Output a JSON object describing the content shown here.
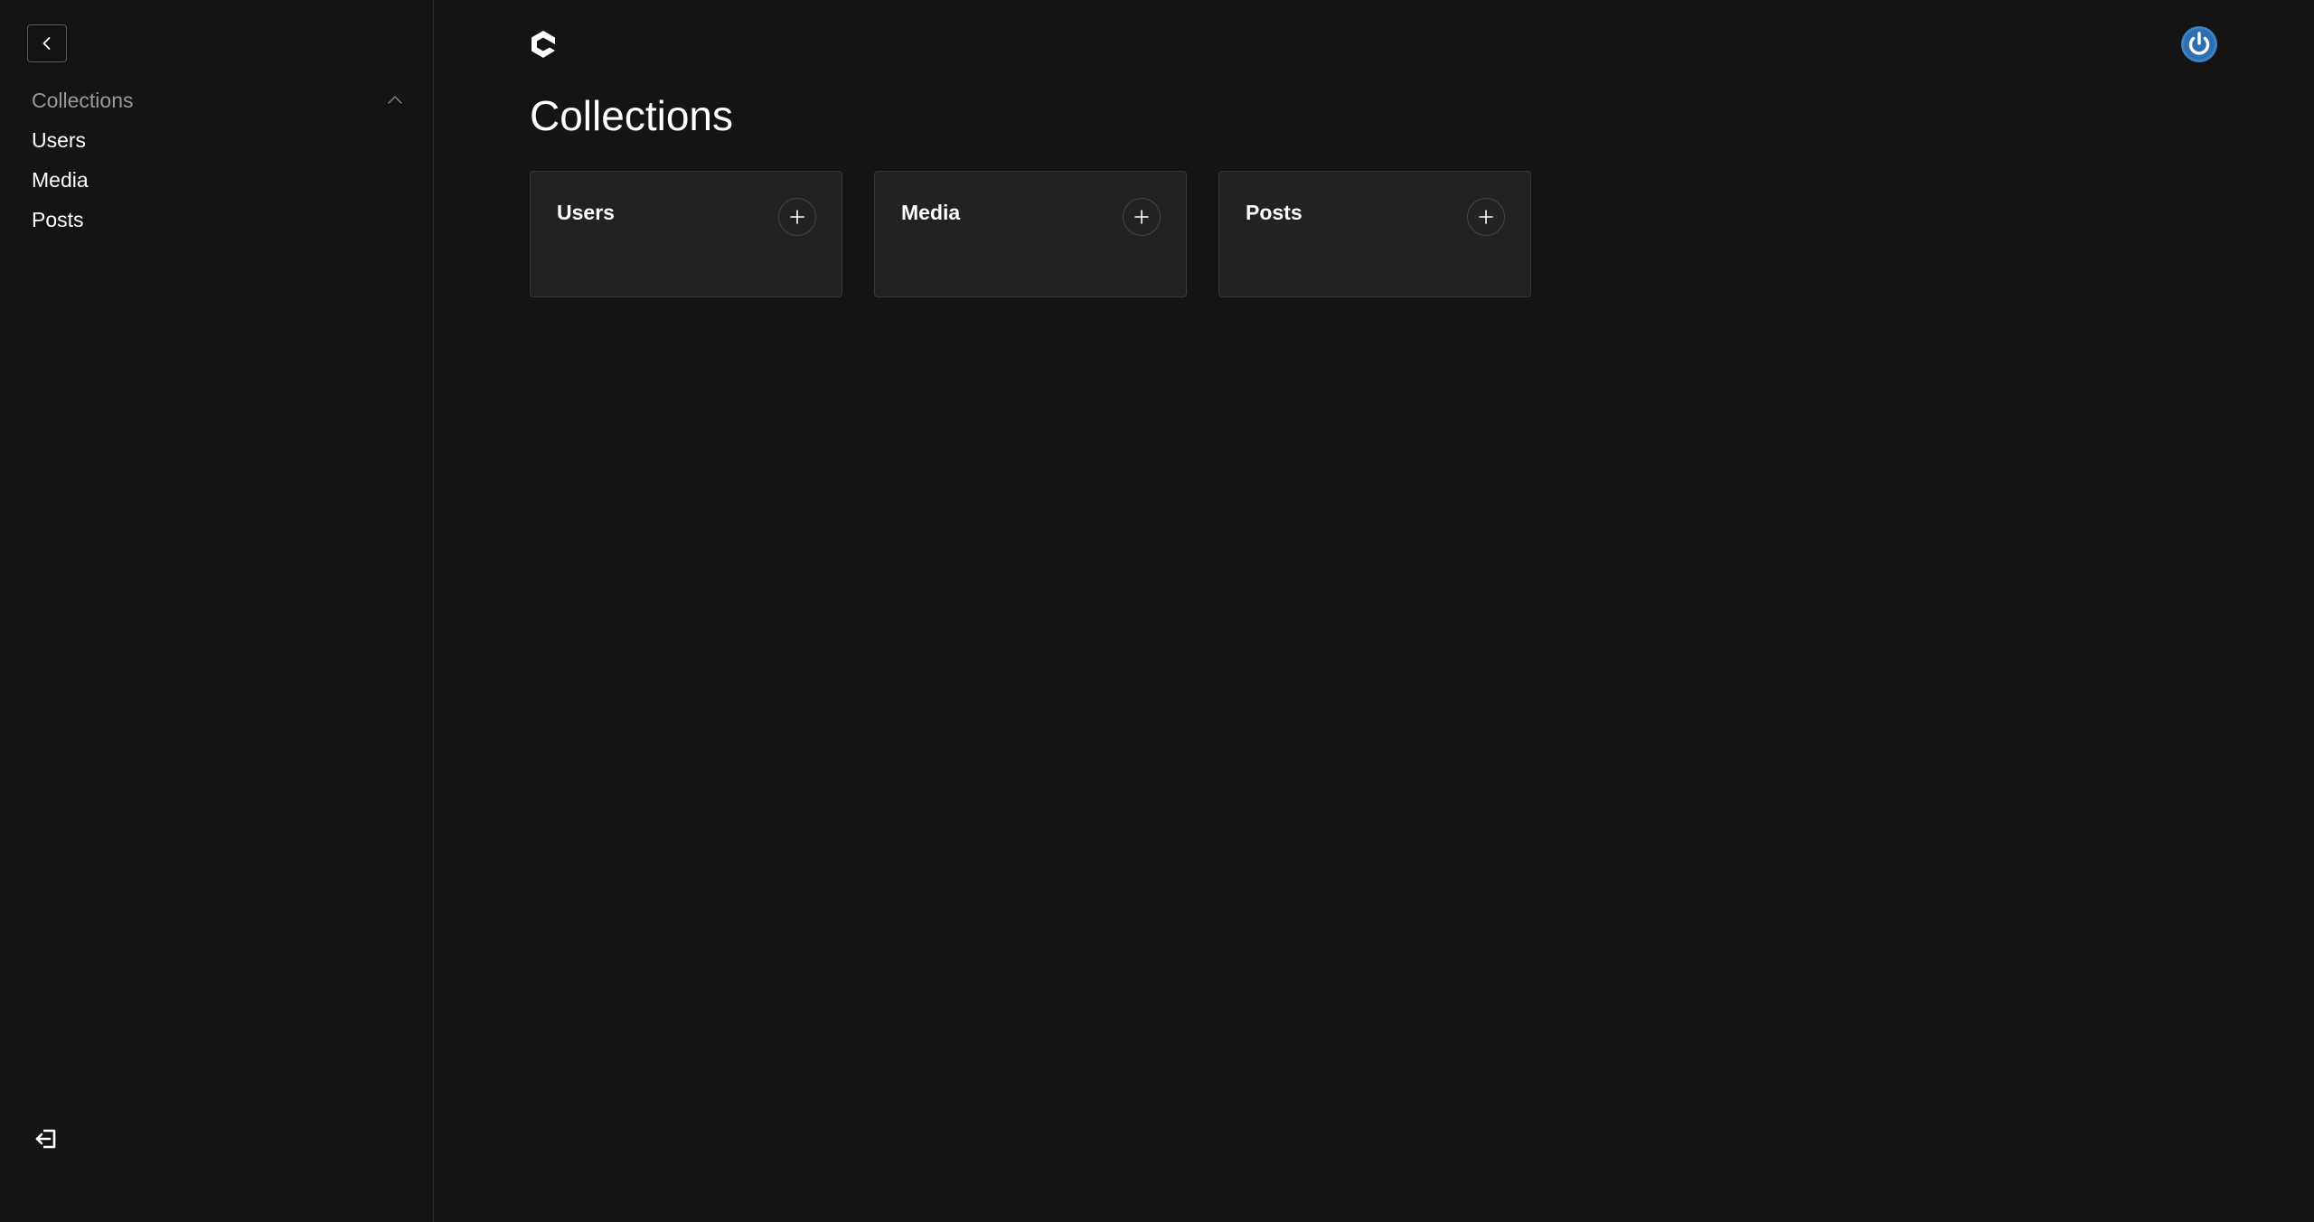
{
  "sidebar": {
    "collapse_icon": "chevron-left-icon",
    "group": {
      "label": "Collections",
      "toggle_icon": "chevron-up-icon",
      "items": [
        {
          "label": "Users"
        },
        {
          "label": "Media"
        },
        {
          "label": "Posts"
        }
      ]
    },
    "logout_icon": "logout-icon"
  },
  "header": {
    "logo_icon": "payload-logo-icon",
    "account_icon": "account-avatar-icon",
    "account_color": "#3b82c4"
  },
  "main": {
    "title": "Collections",
    "cards": [
      {
        "title": "Users",
        "add_icon": "plus-icon"
      },
      {
        "title": "Media",
        "add_icon": "plus-icon"
      },
      {
        "title": "Posts",
        "add_icon": "plus-icon"
      }
    ]
  },
  "colors": {
    "background": "#141414",
    "card_background": "#222222",
    "muted_text": "#9a9a9a"
  }
}
